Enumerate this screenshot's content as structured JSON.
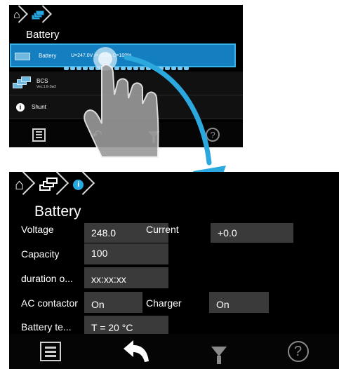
{
  "top_screen": {
    "title": "Battery",
    "rows": [
      {
        "label": "Battery",
        "values": "U=247.0V   I=+0.0A   C=100%",
        "selected": true
      },
      {
        "label": "BCS",
        "sub": "Vec:1.6-Sw2",
        "selected": false
      },
      {
        "label": "Shunt",
        "selected": false
      }
    ]
  },
  "bottom_screen": {
    "title": "Battery",
    "properties": [
      {
        "label": "Voltage",
        "value": "248.0"
      },
      {
        "label": "Current",
        "value": "+0.0"
      },
      {
        "label": "Capacity",
        "value": "100"
      },
      {
        "label": "duration o...",
        "value": "xx:xx:xx"
      },
      {
        "label": "AC contactor",
        "value": "On"
      },
      {
        "label": "Charger",
        "value": "On"
      },
      {
        "label": "Battery te...",
        "value": "T = 20 °C"
      }
    ]
  },
  "icons": {
    "home": "home-icon",
    "battery": "battery-icon",
    "stack": "stack-icon",
    "info": "info-icon",
    "menu": "menu-icon",
    "back": "back-icon",
    "filter": "filter-icon",
    "help": "help-icon"
  },
  "colors": {
    "accent": "#29a9e1",
    "selected_row": "#137fc0",
    "field_bg": "#3a3a3a",
    "screen_bg": "#000000"
  }
}
